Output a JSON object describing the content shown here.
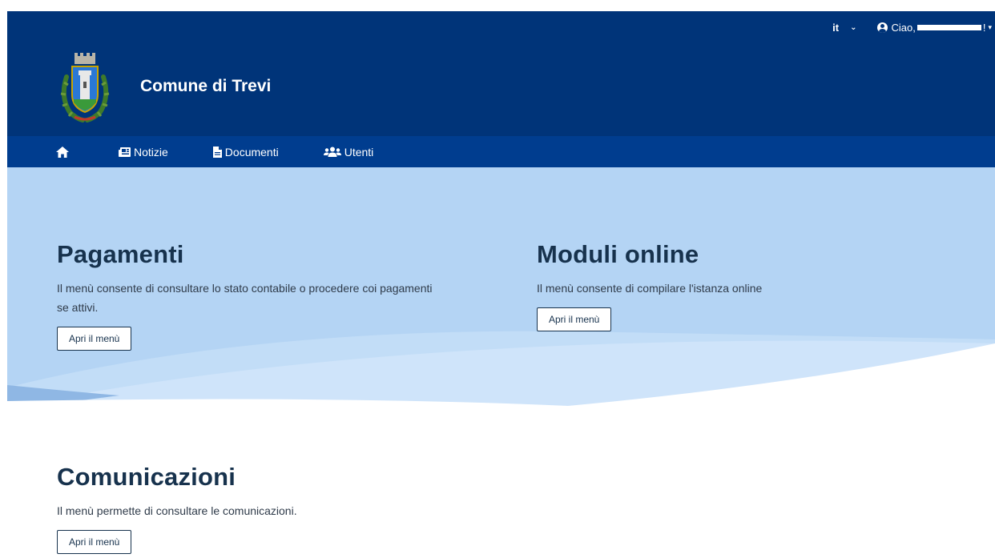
{
  "header": {
    "lang": "it",
    "greeting_prefix": "Ciao,",
    "greeting_suffix": "!",
    "title": "Comune di Trevi"
  },
  "nav": {
    "items": [
      {
        "label": "Notizie",
        "icon": "newspaper-icon"
      },
      {
        "label": "Documenti",
        "icon": "file-icon"
      },
      {
        "label": "Utenti",
        "icon": "users-icon"
      }
    ]
  },
  "sections": {
    "pagamenti": {
      "title": "Pagamenti",
      "description": "Il menù consente di consultare lo stato contabile o procedere coi pagamenti se attivi.",
      "button": "Apri il menù"
    },
    "moduli": {
      "title": "Moduli online",
      "description": "Il menù consente di compilare l'istanza online",
      "button": "Apri il menù"
    },
    "comunicazioni": {
      "title": "Comunicazioni",
      "description": "Il menù permette di consultare le comunicazioni.",
      "button": "Apri il menù"
    }
  },
  "colors": {
    "header_bg": "#003479",
    "nav_bg": "#003d8f",
    "hero_bg": "#b4d4f4",
    "title_color": "#17324d"
  }
}
